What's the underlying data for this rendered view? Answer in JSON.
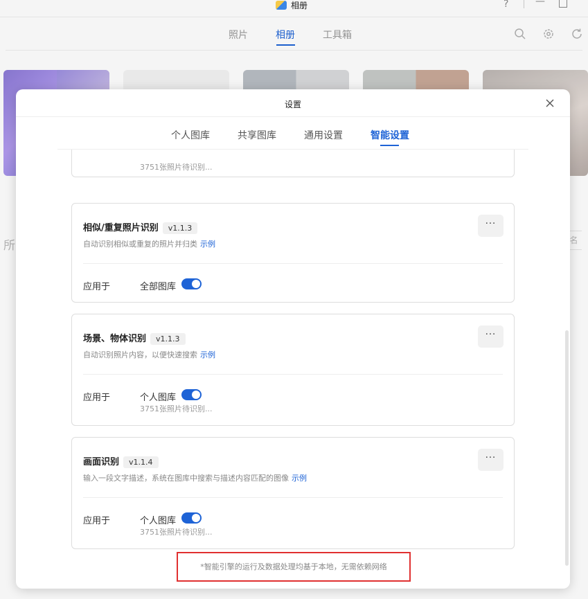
{
  "app": {
    "title": "相册",
    "help_glyph": "?",
    "minimize_glyph": "—"
  },
  "main_tabs": [
    {
      "label": "照片"
    },
    {
      "label": "相册"
    },
    {
      "label": "工具箱"
    }
  ],
  "background": {
    "side_text": "所",
    "right_fragment": "名"
  },
  "dialog": {
    "title": "设置",
    "tabs": [
      {
        "label": "个人图库"
      },
      {
        "label": "共享图库"
      },
      {
        "label": "通用设置"
      },
      {
        "label": "智能设置"
      }
    ],
    "active_tab": "智能设置",
    "cards": [
      {
        "pending": "3751张照片待识别..."
      },
      {
        "title": "相似/重复照片识别",
        "version": "v1.1.3",
        "description": "自动识别相似或重复的照片并归类",
        "link": "示例",
        "more": "···",
        "apply_label": "应用于",
        "apply_target": "全部图库",
        "enabled": true
      },
      {
        "title": "场景、物体识别",
        "version": "v1.1.3",
        "description": "自动识别照片内容，以便快速搜索",
        "link": "示例",
        "more": "···",
        "apply_label": "应用于",
        "apply_target": "个人图库",
        "enabled": true,
        "pending": "3751张照片待识别..."
      },
      {
        "title": "画面识别",
        "version": "v1.1.4",
        "description": "输入一段文字描述，系统在图库中搜索与描述内容匹配的图像",
        "link": "示例",
        "more": "···",
        "apply_label": "应用于",
        "apply_target": "个人图库",
        "enabled": true,
        "pending": "3751张照片待识别..."
      }
    ],
    "footer_note": "*智能引擎的运行及数据处理均基于本地，无需依赖网络"
  },
  "colors": {
    "accent": "#1e63d6",
    "highlight_border": "#e03030"
  }
}
